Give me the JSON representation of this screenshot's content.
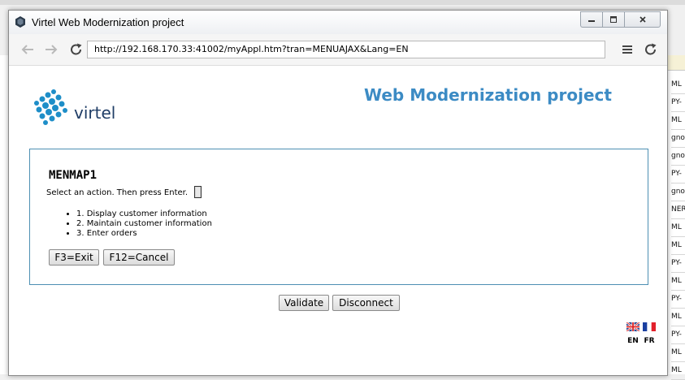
{
  "window": {
    "title": "Virtel Web Modernization project"
  },
  "browser": {
    "url": "http://192.168.170.33:41002/myAppl.htm?tran=MENUAJAX&Lang=EN"
  },
  "header": {
    "logo_text": "virtel",
    "heading": "Web Modernization project"
  },
  "panel": {
    "title": "MENMAP1",
    "prompt": "Select an action. Then press Enter.",
    "options": [
      "1. Display customer information",
      "2. Maintain customer information",
      "3. Enter orders"
    ],
    "f3_label": "F3=Exit",
    "f12_label": "F12=Cancel"
  },
  "actions": {
    "validate_label": "Validate",
    "disconnect_label": "Disconnect"
  },
  "languages": [
    {
      "code": "EN",
      "icon": "uk-flag-icon"
    },
    {
      "code": "FR",
      "icon": "france-flag-icon"
    }
  ],
  "background_app": {
    "rows": [
      "ML",
      "PY-",
      "ML",
      "gnor",
      "gnor",
      "PY-",
      "gnor",
      "NER",
      "ML",
      "ML",
      "PY-",
      "ML",
      "PY-",
      "ML",
      "PY-",
      "ML",
      "ML"
    ]
  },
  "colors": {
    "heading": "#3c8bc4",
    "panel_border": "#4d8fb3",
    "logo_dots": "#1e8ec8",
    "logo_text": "#1f3d66"
  }
}
